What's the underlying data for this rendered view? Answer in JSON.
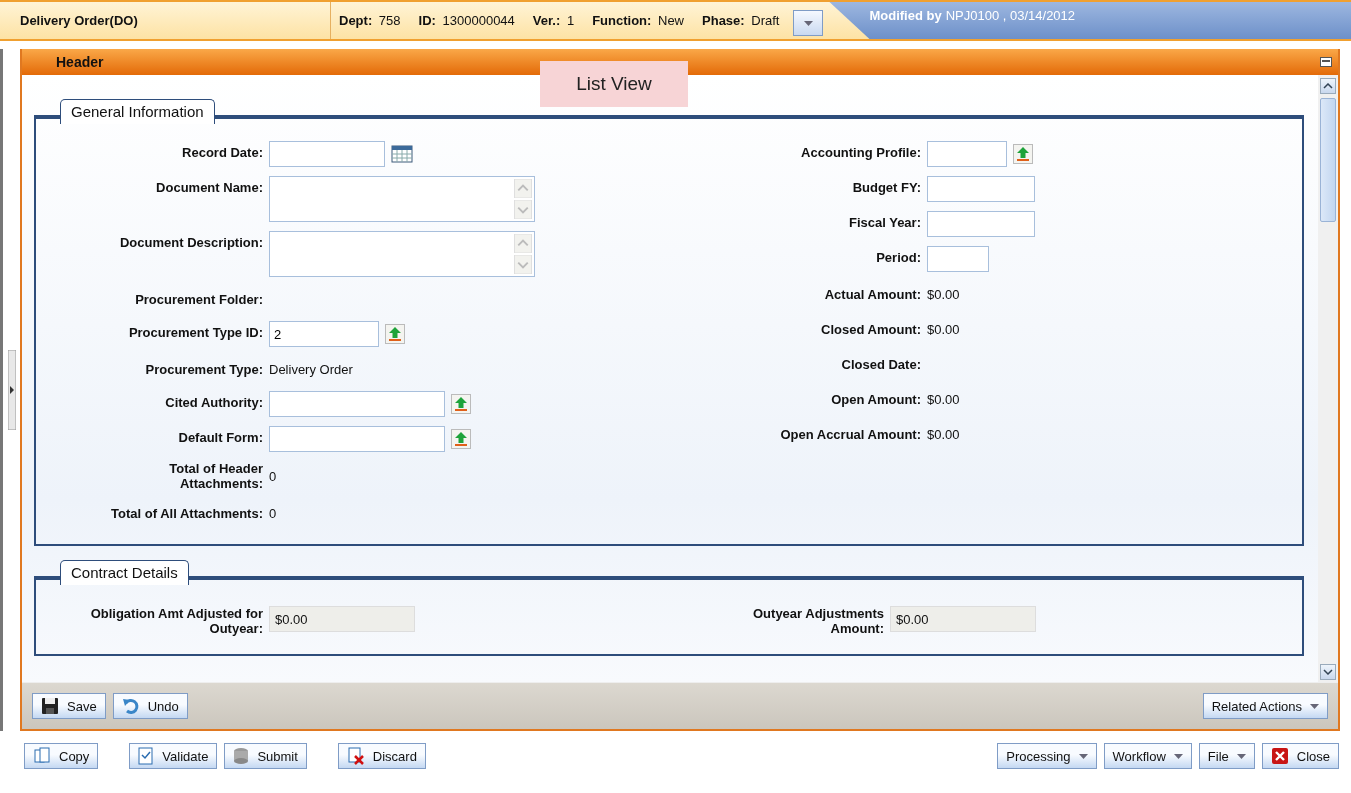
{
  "title_bar": {
    "title": "Delivery Order(DO)",
    "info": [
      {
        "label": "Dept:",
        "value": "758"
      },
      {
        "label": "ID:",
        "value": "1300000044"
      },
      {
        "label": "Ver.:",
        "value": "1"
      },
      {
        "label": "Function:",
        "value": "New"
      },
      {
        "label": "Phase:",
        "value": "Draft"
      }
    ],
    "modified": {
      "label": "Modified by",
      "value": "NPJ0100 , 03/14/2012"
    }
  },
  "panel": {
    "title": "Header",
    "tooltip": "List View",
    "sections": [
      {
        "title": "General Information",
        "left": [
          {
            "label": "Record Date:",
            "kind": "date"
          },
          {
            "label": "Document Name:",
            "kind": "textarea"
          },
          {
            "label": "Document Description:",
            "kind": "textarea"
          },
          {
            "label": "Procurement Folder:",
            "kind": "text"
          },
          {
            "label": "Procurement Type ID:",
            "kind": "short-lookup",
            "value": "2"
          },
          {
            "label": "Procurement Type:",
            "kind": "text",
            "value": "Delivery Order"
          },
          {
            "label": "Cited Authority:",
            "kind": "lookup"
          },
          {
            "label": "Default Form:",
            "kind": "lookup"
          },
          {
            "label": "Total of Header Attachments:",
            "kind": "text",
            "value": "0"
          },
          {
            "label": "Total of All Attachments:",
            "kind": "text",
            "value": "0"
          }
        ],
        "right": [
          {
            "label": "Accounting Profile:",
            "kind": "short-lookup"
          },
          {
            "label": "Budget FY:",
            "kind": "input"
          },
          {
            "label": "Fiscal Year:",
            "kind": "input"
          },
          {
            "label": "Period:",
            "kind": "short-input"
          },
          {
            "label": "Actual Amount:",
            "kind": "text",
            "value": "$0.00"
          },
          {
            "label": "Closed Amount:",
            "kind": "text",
            "value": "$0.00"
          },
          {
            "label": "Closed Date:",
            "kind": "text"
          },
          {
            "label": "Open Amount:",
            "kind": "text",
            "value": "$0.00"
          },
          {
            "label": "Open Accrual Amount:",
            "kind": "text",
            "value": "$0.00"
          }
        ]
      },
      {
        "title": "Contract Details",
        "left": [
          {
            "label": "Obligation Amt Adjusted for Outyear:",
            "kind": "readonly",
            "value": "$0.00"
          }
        ],
        "right": [
          {
            "label": "Outyear Adjustments Amount:",
            "kind": "readonly",
            "value": "$0.00"
          }
        ]
      }
    ]
  },
  "toolbar": {
    "left": [
      {
        "label": "Save",
        "kind": "save"
      },
      {
        "label": "Undo",
        "kind": "undo"
      }
    ],
    "right": [
      {
        "label": "Related Actions",
        "kind": "menu"
      }
    ]
  },
  "footer": {
    "left": [
      {
        "label": "Copy",
        "kind": "copy"
      },
      {
        "label": "Validate",
        "kind": "validate"
      },
      {
        "label": "Submit",
        "kind": "submit"
      },
      {
        "label": "Discard",
        "kind": "discard"
      }
    ],
    "right": [
      {
        "label": "Processing",
        "kind": "menu"
      },
      {
        "label": "Workflow",
        "kind": "menu"
      },
      {
        "label": "File",
        "kind": "menu"
      },
      {
        "label": "Close",
        "kind": "close"
      }
    ]
  }
}
